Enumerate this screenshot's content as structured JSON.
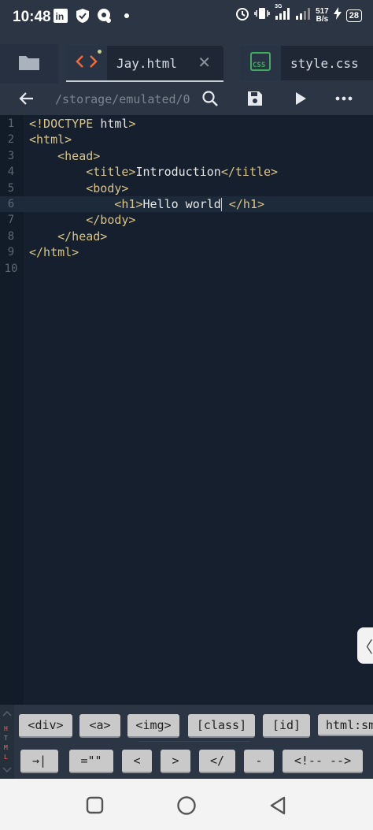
{
  "status": {
    "time": "10:48",
    "net_speed_value": "517",
    "net_speed_unit": "B/s",
    "battery": "28",
    "net_type": "3G"
  },
  "tabs": [
    {
      "label": "Jay.html",
      "icon": "html-code-icon",
      "active": true
    },
    {
      "label": "style.css",
      "icon": "css-icon",
      "active": false
    }
  ],
  "toolbar": {
    "path": "/storage/emulated/0"
  },
  "editor": {
    "lines": [
      {
        "num": "1",
        "indent": "",
        "parts": [
          {
            "t": "tag",
            "v": "<!DOCTYPE "
          },
          {
            "t": "txt",
            "v": "html"
          },
          {
            "t": "tag",
            "v": ">"
          }
        ]
      },
      {
        "num": "2",
        "indent": "",
        "parts": [
          {
            "t": "tag",
            "v": "<html>"
          }
        ]
      },
      {
        "num": "3",
        "indent": "    ",
        "parts": [
          {
            "t": "tag",
            "v": "<head>"
          }
        ]
      },
      {
        "num": "4",
        "indent": "        ",
        "parts": [
          {
            "t": "tag",
            "v": "<title>"
          },
          {
            "t": "txt",
            "v": "Introduction"
          },
          {
            "t": "tag",
            "v": "</title>"
          }
        ]
      },
      {
        "num": "5",
        "indent": "        ",
        "parts": [
          {
            "t": "tag",
            "v": "<body>"
          }
        ]
      },
      {
        "num": "6",
        "indent": "            ",
        "parts": [
          {
            "t": "tag",
            "v": "<h1>"
          },
          {
            "t": "txt",
            "v": "Hello world"
          },
          {
            "t": "cursor",
            "v": ""
          },
          {
            "t": "txt",
            "v": " "
          },
          {
            "t": "tag",
            "v": "</h1>"
          }
        ]
      },
      {
        "num": "7",
        "indent": "        ",
        "parts": [
          {
            "t": "tag",
            "v": "</body>"
          }
        ]
      },
      {
        "num": "8",
        "indent": "    ",
        "parts": [
          {
            "t": "tag",
            "v": "</head>"
          }
        ]
      },
      {
        "num": "9",
        "indent": "",
        "parts": [
          {
            "t": "tag",
            "v": "</html>"
          }
        ]
      },
      {
        "num": "10",
        "indent": "",
        "parts": []
      }
    ],
    "highlight_line": 6
  },
  "language_strip": [
    "H",
    "T",
    "M",
    "L"
  ],
  "symbols_row1": [
    "<div>",
    "<a>",
    "<img>",
    "[class]",
    "[id]",
    "html:sm"
  ],
  "symbols_row2": [
    "→|",
    "=\"\"",
    "<",
    ">",
    "</",
    "-",
    "<!-- -->"
  ],
  "colors": {
    "tag": "#d9c48a",
    "text": "#e8e8e8",
    "background": "#151f2d",
    "chrome": "#2b3543"
  }
}
